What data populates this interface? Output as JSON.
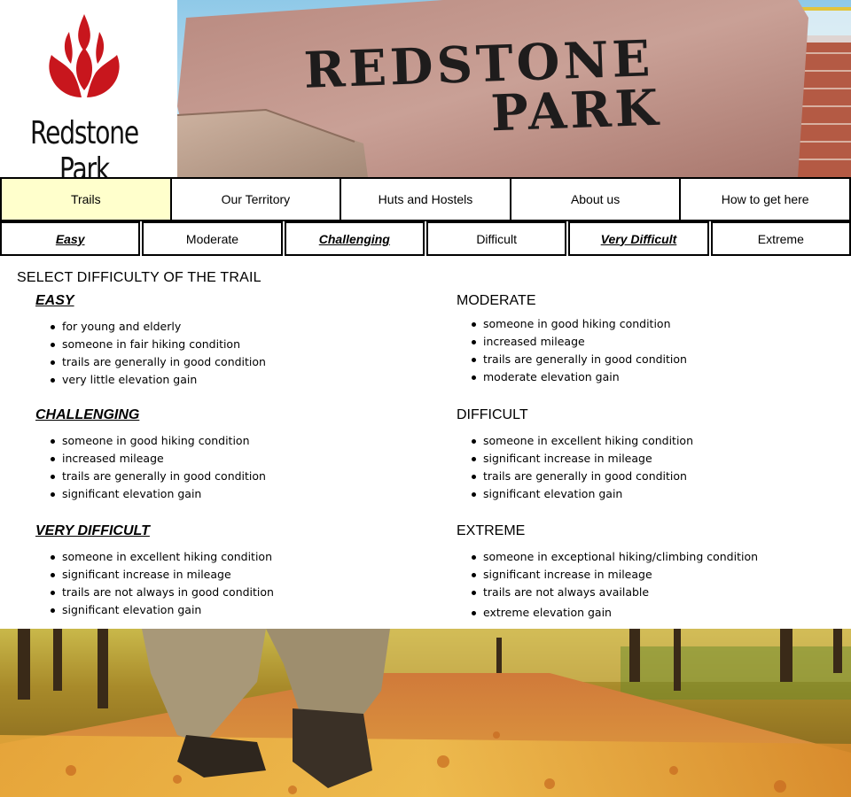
{
  "logo": {
    "text": "Redstone Park",
    "icon": "tulip-flower-icon",
    "color": "#c8161d"
  },
  "banner": {
    "line1": "REDSTONE",
    "line2": "PARK",
    "image": "redstone-park-sign-rock"
  },
  "nav": {
    "items": [
      {
        "label": "Trails",
        "active": true
      },
      {
        "label": "Our Territory"
      },
      {
        "label": "Huts and Hostels"
      },
      {
        "label": "About us"
      },
      {
        "label": "How to get here"
      }
    ],
    "active_color": "#ffffcc"
  },
  "subnav": {
    "items": [
      {
        "label": "Easy"
      },
      {
        "label": "Moderate"
      },
      {
        "label": "Challenging"
      },
      {
        "label": "Difficult"
      },
      {
        "label": "Very Difficult"
      },
      {
        "label": "Extreme"
      }
    ]
  },
  "page_title": "SELECT DIFFICULTY OF THE TRAIL",
  "sections": [
    {
      "heading": "EASY",
      "items": [
        "for young and elderly",
        "someone in fair hiking condition",
        "trails are generally in good condition",
        "very little elevation gain"
      ]
    },
    {
      "heading": "MODERATE",
      "items": [
        "someone in good hiking condition",
        "increased mileage",
        "trails are generally in good condition",
        "moderate elevation gain"
      ]
    },
    {
      "heading": "CHALLENGING",
      "items": [
        "someone in good hiking condition",
        "increased mileage",
        "trails are generally in good condition",
        "significant elevation gain"
      ]
    },
    {
      "heading": "DIFFICULT",
      "items": [
        "someone in excellent hiking condition",
        "significant increase in mileage",
        "trails are generally in good condition",
        "significant elevation gain"
      ]
    },
    {
      "heading": "VERY DIFFICULT",
      "items": [
        "someone in excellent hiking condition",
        "significant increase in mileage",
        "trails are not always in good condition",
        "significant elevation gain"
      ]
    },
    {
      "heading": "EXTREME",
      "items": [
        "someone in exceptional hiking/climbing condition",
        "significant increase in mileage",
        "trails are not always available",
        "extreme elevation gain"
      ]
    }
  ],
  "footer_image": "hiker-autumn-trail-photo"
}
